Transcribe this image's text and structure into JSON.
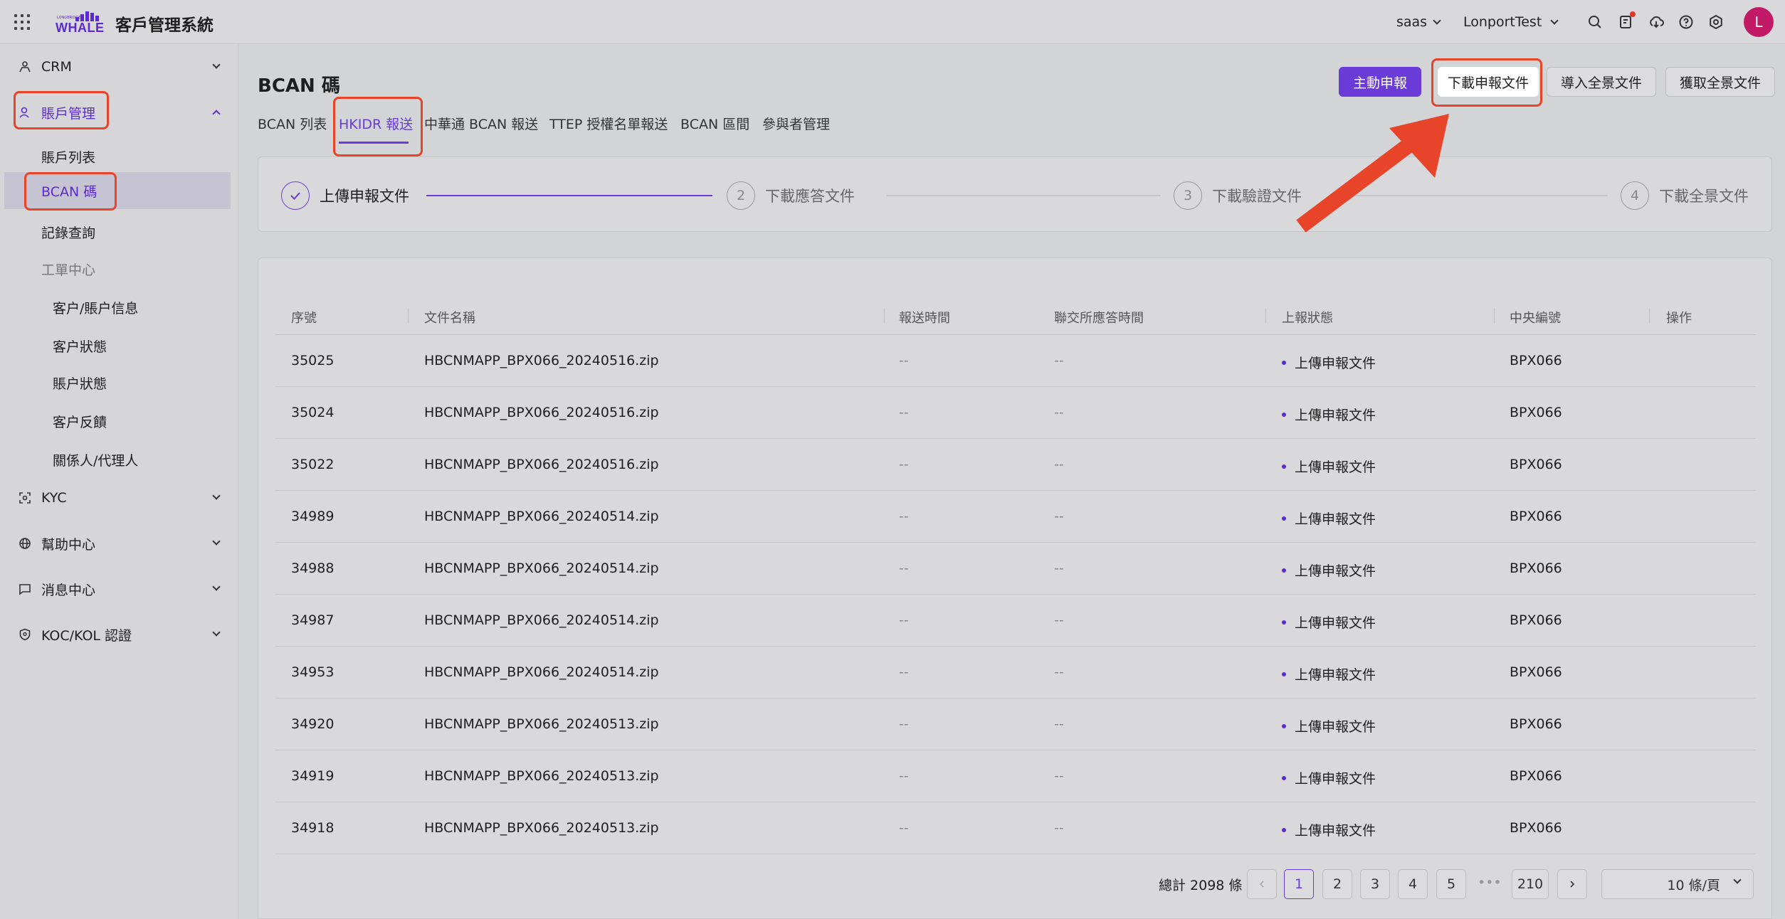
{
  "header": {
    "logo_tiny": "LONGBRIDGE",
    "logo_word": "WHALE",
    "app_title": "客戶管理系統",
    "tenant": "saas",
    "user": "LonportTest",
    "avatar_letter": "L"
  },
  "sidebar": {
    "crm": "CRM",
    "account_mgmt": "賬戶管理",
    "account_list": "賬戶列表",
    "bcan_code": "BCAN 碼",
    "records": "記錄查詢",
    "work_order_center": "工單中心",
    "customer_account_info": "客户/賬户信息",
    "customer_status": "客户狀態",
    "account_status": "賬户狀態",
    "customer_feedback": "客户反饋",
    "related_agent": "關係人/代理人",
    "kyc": "KYC",
    "help_center": "幫助中心",
    "message_center": "消息中心",
    "koc_kol": "KOC/KOL 認證"
  },
  "main": {
    "title": "BCAN 碼",
    "buttons": {
      "declare": "主動申報",
      "download_declare": "下載申報文件",
      "import_full": "導入全景文件",
      "fetch_full": "獲取全景文件"
    },
    "tabs": [
      "BCAN 列表",
      "HKIDR 報送",
      "中華通 BCAN 報送",
      "TTEP 授權名單報送",
      "BCAN 區間",
      "參與者管理"
    ],
    "steps": [
      {
        "num": "",
        "label": "上傳申報文件"
      },
      {
        "num": "2",
        "label": "下載應答文件"
      },
      {
        "num": "3",
        "label": "下載驗證文件"
      },
      {
        "num": "4",
        "label": "下載全景文件"
      }
    ],
    "table": {
      "headers": [
        "序號",
        "文件名稱",
        "報送時間",
        "聯交所應答時間",
        "上報狀態",
        "中央編號",
        "操作"
      ],
      "rows": [
        {
          "id": "35025",
          "file": "HBCNMAPP_BPX066_20240516.zip",
          "sent": "--",
          "reply": "--",
          "status": "上傳申報文件",
          "ccass": "BPX066"
        },
        {
          "id": "35024",
          "file": "HBCNMAPP_BPX066_20240516.zip",
          "sent": "--",
          "reply": "--",
          "status": "上傳申報文件",
          "ccass": "BPX066"
        },
        {
          "id": "35022",
          "file": "HBCNMAPP_BPX066_20240516.zip",
          "sent": "--",
          "reply": "--",
          "status": "上傳申報文件",
          "ccass": "BPX066"
        },
        {
          "id": "34989",
          "file": "HBCNMAPP_BPX066_20240514.zip",
          "sent": "--",
          "reply": "--",
          "status": "上傳申報文件",
          "ccass": "BPX066"
        },
        {
          "id": "34988",
          "file": "HBCNMAPP_BPX066_20240514.zip",
          "sent": "--",
          "reply": "--",
          "status": "上傳申報文件",
          "ccass": "BPX066"
        },
        {
          "id": "34987",
          "file": "HBCNMAPP_BPX066_20240514.zip",
          "sent": "--",
          "reply": "--",
          "status": "上傳申報文件",
          "ccass": "BPX066"
        },
        {
          "id": "34953",
          "file": "HBCNMAPP_BPX066_20240514.zip",
          "sent": "--",
          "reply": "--",
          "status": "上傳申報文件",
          "ccass": "BPX066"
        },
        {
          "id": "34920",
          "file": "HBCNMAPP_BPX066_20240513.zip",
          "sent": "--",
          "reply": "--",
          "status": "上傳申報文件",
          "ccass": "BPX066"
        },
        {
          "id": "34919",
          "file": "HBCNMAPP_BPX066_20240513.zip",
          "sent": "--",
          "reply": "--",
          "status": "上傳申報文件",
          "ccass": "BPX066"
        },
        {
          "id": "34918",
          "file": "HBCNMAPP_BPX066_20240513.zip",
          "sent": "--",
          "reply": "--",
          "status": "上傳申報文件",
          "ccass": "BPX066"
        }
      ]
    },
    "pagination": {
      "total": "總計 2098 條",
      "pages": [
        "1",
        "2",
        "3",
        "4",
        "5"
      ],
      "ellipsis": "•••",
      "last": "210",
      "page_size": "10 條/頁"
    }
  },
  "colors": {
    "accent": "#6a3bd7",
    "highlight": "#e8442a",
    "avatar": "#c21a67"
  }
}
